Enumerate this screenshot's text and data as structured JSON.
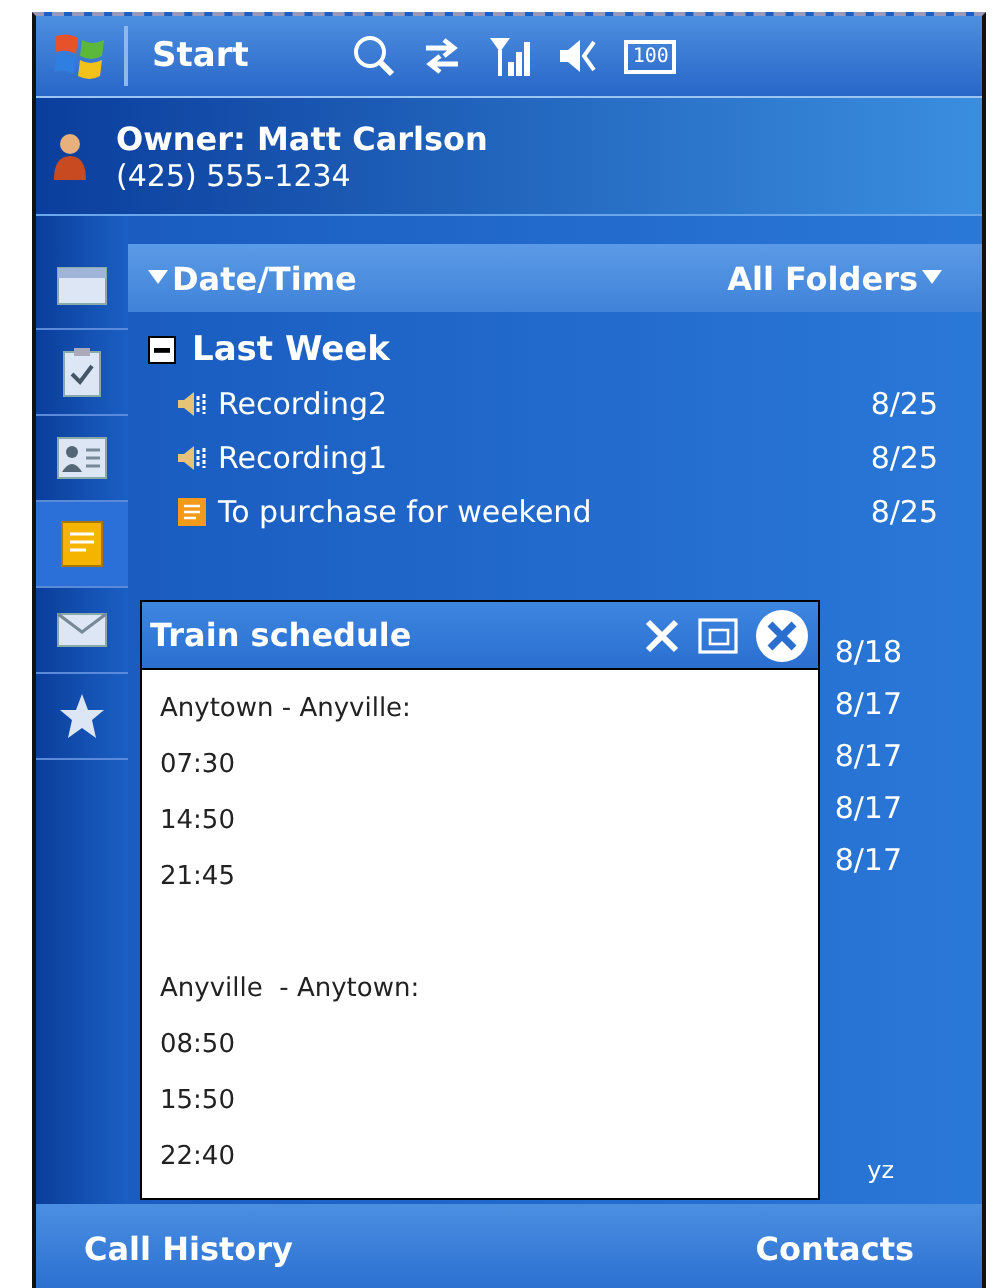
{
  "status_bar": {
    "start_label": "Start",
    "battery": "100"
  },
  "owner": {
    "name": "Owner: Matt Carlson",
    "phone": "(425) 555-1234"
  },
  "side_icons": [
    {
      "kind": "calendar",
      "selected": false
    },
    {
      "kind": "tasks",
      "selected": false
    },
    {
      "kind": "contacts",
      "selected": false
    },
    {
      "kind": "notes",
      "selected": true
    },
    {
      "kind": "mail",
      "selected": false
    },
    {
      "kind": "favorites",
      "selected": false
    }
  ],
  "list_header": {
    "sort": "Date/Time",
    "folder": "All Folders"
  },
  "groups": [
    {
      "title": "Last Week",
      "expanded": true,
      "items": [
        {
          "kind": "recording",
          "name": "Recording2",
          "date": "8/25"
        },
        {
          "kind": "recording",
          "name": "Recording1",
          "date": "8/25"
        },
        {
          "kind": "note",
          "name": "To purchase for weekend",
          "date": "8/25"
        }
      ]
    }
  ],
  "hidden_dates": [
    "8/18",
    "8/17",
    "8/17",
    "8/17",
    "8/17"
  ],
  "alphabet_bar": "yz",
  "popup": {
    "title": "Train schedule",
    "sections": [
      {
        "heading": "Anytown - Anyville:",
        "times": [
          "07:30",
          "14:50",
          "21:45"
        ]
      },
      {
        "heading": "Anyville  - Anytown:",
        "times": [
          "08:50",
          "15:50",
          "22:40"
        ]
      }
    ]
  },
  "softkeys": [
    "Call History",
    "Contacts"
  ]
}
